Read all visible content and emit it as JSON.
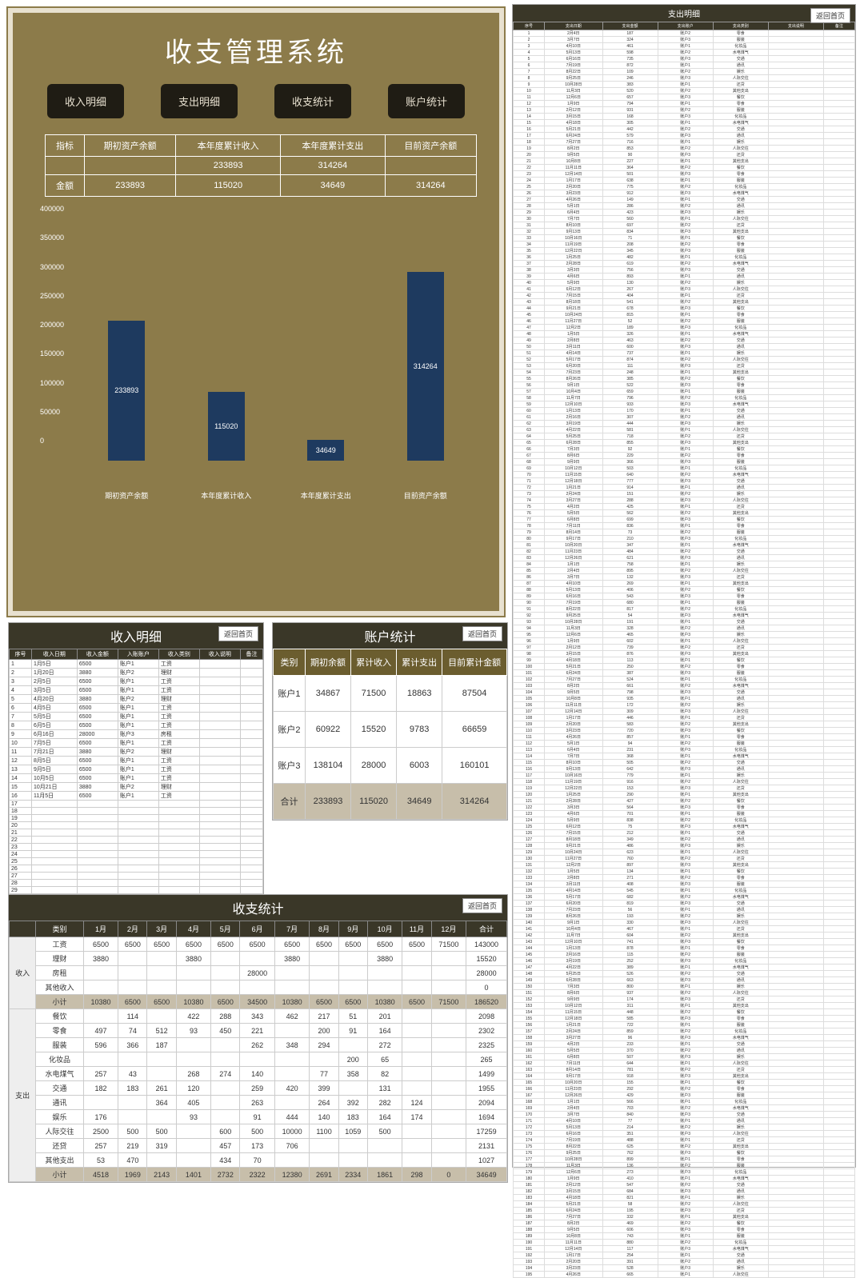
{
  "main": {
    "title": "收支管理系统",
    "nav": [
      "收入明细",
      "支出明细",
      "收支统计",
      "账户统计"
    ],
    "summary": {
      "h": [
        "指标",
        "期初资产余额",
        "本年度累计收入",
        "本年度累计支出",
        "目前资产余额"
      ],
      "r1": [
        "",
        "",
        "233893",
        "314264",
        ""
      ],
      "r2": [
        "金额",
        "233893",
        "115020",
        "34649",
        "314264"
      ]
    }
  },
  "chart_data": {
    "type": "bar",
    "categories": [
      "期初资产余额",
      "本年度累计收入",
      "本年度累计支出",
      "目前资产余额"
    ],
    "values": [
      233893,
      115020,
      34649,
      314264
    ],
    "data_labels": [
      "233893",
      "115020",
      "34649",
      "314264"
    ],
    "ylim": [
      0,
      400000
    ],
    "yticks": [
      400000,
      350000,
      300000,
      250000,
      200000,
      150000,
      100000,
      50000,
      0
    ]
  },
  "income": {
    "title": "收入明细",
    "back": "返回首页",
    "headers": [
      "序号",
      "收入日期",
      "收入金额",
      "入账账户",
      "收入类别",
      "收入说明",
      "备注"
    ],
    "rows": [
      [
        "1",
        "1月5日",
        "6500",
        "账户1",
        "工资",
        "",
        ""
      ],
      [
        "2",
        "1月20日",
        "3880",
        "账户2",
        "理财",
        "",
        ""
      ],
      [
        "3",
        "2月5日",
        "6500",
        "账户1",
        "工资",
        "",
        ""
      ],
      [
        "4",
        "3月5日",
        "6500",
        "账户1",
        "工资",
        "",
        ""
      ],
      [
        "5",
        "4月20日",
        "3880",
        "账户2",
        "理财",
        "",
        ""
      ],
      [
        "6",
        "4月5日",
        "6500",
        "账户1",
        "工资",
        "",
        ""
      ],
      [
        "7",
        "5月5日",
        "6500",
        "账户1",
        "工资",
        "",
        ""
      ],
      [
        "8",
        "6月5日",
        "6500",
        "账户1",
        "工资",
        "",
        ""
      ],
      [
        "9",
        "6月16日",
        "28000",
        "账户3",
        "房租",
        "",
        ""
      ],
      [
        "10",
        "7月5日",
        "6500",
        "账户1",
        "工资",
        "",
        ""
      ],
      [
        "11",
        "7月21日",
        "3880",
        "账户2",
        "理财",
        "",
        ""
      ],
      [
        "12",
        "8月5日",
        "6500",
        "账户1",
        "工资",
        "",
        ""
      ],
      [
        "13",
        "9月5日",
        "6500",
        "账户1",
        "工资",
        "",
        ""
      ],
      [
        "14",
        "10月5日",
        "6500",
        "账户1",
        "工资",
        "",
        ""
      ],
      [
        "15",
        "10月21日",
        "3880",
        "账户2",
        "理财",
        "",
        ""
      ],
      [
        "16",
        "11月5日",
        "6500",
        "账户1",
        "工资",
        "",
        ""
      ]
    ],
    "blank_rows": 14
  },
  "account": {
    "title": "账户统计",
    "back": "返回首页",
    "headers": [
      "类别",
      "期初余额",
      "累计收入",
      "累计支出",
      "目前累计金额"
    ],
    "rows": [
      [
        "账户1",
        "34867",
        "71500",
        "18863",
        "87504"
      ],
      [
        "账户2",
        "60922",
        "15520",
        "9783",
        "66659"
      ],
      [
        "账户3",
        "138104",
        "28000",
        "6003",
        "160101"
      ]
    ],
    "total": [
      "合计",
      "233893",
      "115020",
      "34649",
      "314264"
    ]
  },
  "stats": {
    "title": "收支统计",
    "back": "返回首页",
    "cols": [
      "类别",
      "1月",
      "2月",
      "3月",
      "4月",
      "5月",
      "6月",
      "7月",
      "8月",
      "9月",
      "10月",
      "11月",
      "12月",
      "合计"
    ],
    "in_label": "收入",
    "out_label": "支出",
    "income_rows": [
      [
        "工资",
        "6500",
        "6500",
        "6500",
        "6500",
        "6500",
        "6500",
        "6500",
        "6500",
        "6500",
        "6500",
        "6500",
        "71500",
        "143000"
      ],
      [
        "理财",
        "3880",
        "",
        "",
        "3880",
        "",
        "",
        "3880",
        "",
        "",
        "3880",
        "",
        "",
        "15520"
      ],
      [
        "房租",
        "",
        "",
        "",
        "",
        "",
        "28000",
        "",
        "",
        "",
        "",
        "",
        "",
        "28000"
      ],
      [
        "其他收入",
        "",
        "",
        "",
        "",
        "",
        "",
        "",
        "",
        "",
        "",
        "",
        "",
        "0"
      ]
    ],
    "income_sub": [
      "小计",
      "10380",
      "6500",
      "6500",
      "10380",
      "6500",
      "34500",
      "10380",
      "6500",
      "6500",
      "10380",
      "6500",
      "71500",
      "186520"
    ],
    "expense_rows": [
      [
        "餐饮",
        "",
        "114",
        "",
        "422",
        "288",
        "343",
        "462",
        "217",
        "51",
        "201",
        "",
        "",
        "2098"
      ],
      [
        "零食",
        "497",
        "74",
        "512",
        "93",
        "450",
        "221",
        "",
        "200",
        "91",
        "164",
        "",
        "",
        "2302"
      ],
      [
        "服装",
        "596",
        "366",
        "187",
        "",
        "",
        "262",
        "348",
        "294",
        "",
        "272",
        "",
        "",
        "2325"
      ],
      [
        "化妆品",
        "",
        "",
        "",
        "",
        "",
        "",
        "",
        "",
        "200",
        "65",
        "",
        "",
        "265"
      ],
      [
        "水电煤气",
        "257",
        "43",
        "",
        "268",
        "274",
        "140",
        "",
        "77",
        "358",
        "82",
        "",
        "",
        "1499"
      ],
      [
        "交通",
        "182",
        "183",
        "261",
        "120",
        "",
        "259",
        "420",
        "399",
        "",
        "131",
        "",
        "",
        "1955"
      ],
      [
        "通讯",
        "",
        "",
        "364",
        "405",
        "",
        "263",
        "",
        "264",
        "392",
        "282",
        "124",
        "",
        "2094"
      ],
      [
        "娱乐",
        "176",
        "",
        "",
        "93",
        "",
        "91",
        "444",
        "140",
        "183",
        "164",
        "174",
        "",
        "1694"
      ],
      [
        "人际交往",
        "2500",
        "500",
        "500",
        "",
        "600",
        "500",
        "10000",
        "1100",
        "1059",
        "500",
        "",
        "",
        "17259"
      ],
      [
        "还贷",
        "257",
        "219",
        "319",
        "",
        "457",
        "173",
        "706",
        "",
        "",
        "",
        "",
        "",
        "2131"
      ],
      [
        "其他支出",
        "53",
        "470",
        "",
        "",
        "434",
        "70",
        "",
        "",
        "",
        "",
        "",
        "",
        "1027"
      ]
    ],
    "expense_sub": [
      "小计",
      "4518",
      "1969",
      "2143",
      "1401",
      "2732",
      "2322",
      "12380",
      "2691",
      "2334",
      "1861",
      "298",
      "0",
      "34649"
    ]
  },
  "detail": {
    "title": "支出明细",
    "back": "返回首页",
    "headers": [
      "序号",
      "支出日期",
      "支出金额",
      "支出账户",
      "支出类别",
      "支出说明",
      "备注"
    ],
    "rows_count": 195
  }
}
